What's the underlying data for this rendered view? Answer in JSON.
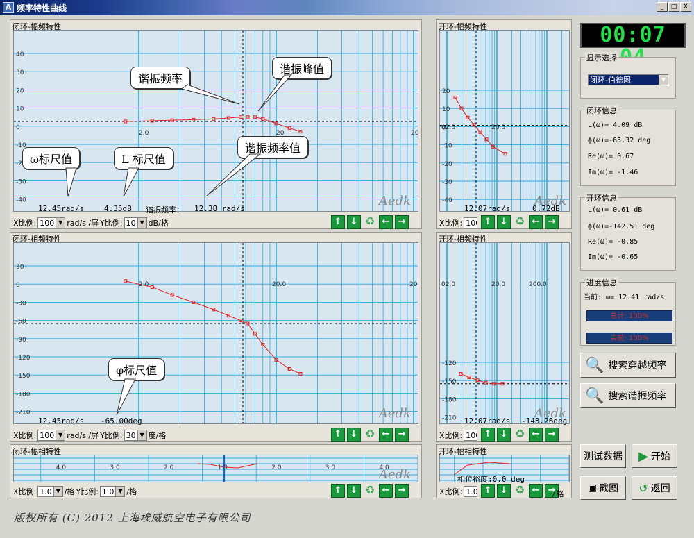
{
  "window": {
    "title": "频率特性曲线",
    "min": "_",
    "max": "□",
    "close": "X"
  },
  "panels": {
    "cl_mag": {
      "title": "闭环-幅频特性",
      "yticks": [
        "40",
        "30",
        "20",
        "10",
        "0",
        "-10",
        "-20",
        "-30",
        "-40"
      ],
      "xticks": [
        "2.0",
        "20",
        "200"
      ],
      "readouts": [
        "12.45rad/s",
        "4.35dB",
        "谐振频率：",
        "12.38 rad/s"
      ],
      "xscale_label": "X比例:",
      "xscale": "100",
      "xunit": "rad/s /屏",
      "yscale_label": "Y比例:",
      "yscale": "10",
      "yunit": "dB/格"
    },
    "cl_phase": {
      "title": "闭环-相频特性",
      "yticks": [
        "30",
        "0",
        "-30",
        "-60",
        "-90",
        "-120",
        "-150",
        "-180",
        "-210"
      ],
      "xticks": [
        "2.0",
        "20.0",
        "200"
      ],
      "readouts": [
        "12.45rad/s",
        "-65.00deg"
      ],
      "xscale_label": "X比例:",
      "xscale": "100",
      "xunit": "rad/s /屏",
      "yscale_label": "Y比例:",
      "yscale": "30",
      "yunit": "度/格"
    },
    "cl_nyq": {
      "title": "闭环-幅相特性",
      "xticks": [
        "4.0",
        "3.0",
        "2.0",
        "1.0",
        "2.0",
        "3.0",
        "4.0"
      ],
      "xscale_label": "X比例:",
      "xscale": "1.0",
      "xunit": "/格",
      "yscale_label": "Y比例:",
      "yscale": "1.0",
      "yunit": "/格"
    },
    "ol_mag": {
      "title": "开环-幅频特性",
      "yticks": [
        "20",
        "10",
        "0",
        "-10",
        "-20",
        "-30",
        "-40"
      ],
      "xticks": [
        "02.0",
        "20.0"
      ],
      "readouts": [
        "12.07rad/s",
        "0.72dB"
      ],
      "xscale_label": "X比例:",
      "xscale": "100"
    },
    "ol_phase": {
      "title": "开环-相频特性",
      "yticks": [
        "-120",
        "-150",
        "-180",
        "-210"
      ],
      "xticks": [
        "02.0",
        "20.0",
        "200.0"
      ],
      "readouts": [
        "12.07rad/s",
        "-143.26deg"
      ],
      "xscale_label": "X比例:",
      "xscale": "100"
    },
    "ol_nyq": {
      "title": "开环-幅相特性",
      "margin": "相位裕度:0.0 deg",
      "xscale_label": "X比例:",
      "xscale": "1.0",
      "yunit": "/格"
    }
  },
  "callouts": {
    "res_freq": "谐振频率",
    "res_peak": "谐振峰值",
    "res_freq_val": "谐振频率值",
    "omega_val": "ω标尺值",
    "l_val": "L 标尺值",
    "phi_val": "φ标尺值"
  },
  "watermark": "Aedk",
  "side": {
    "clock": "00:07 04",
    "display_group": "显示选择",
    "display_value": "闭环-伯德图",
    "cl_info": {
      "title": "闭环信息",
      "lines": [
        "L(ω)=  4.09 dB",
        "ф(ω)=-65.32 deg",
        "Re(ω)=  0.67",
        "Im(ω)= -1.46"
      ]
    },
    "ol_info": {
      "title": "开环信息",
      "lines": [
        "L(ω)=  0.61 dB",
        "ф(ω)=-142.51 deg",
        "Re(ω)= -0.85",
        "Im(ω)= -0.65"
      ]
    },
    "progress": {
      "title": "进度信息",
      "current": "当前: ω= 12.41 rad/s",
      "total": "总计: 100%",
      "now": "当前: 100%"
    },
    "btn_cross": "搜索穿越频率",
    "btn_res": "搜索谐振频率",
    "btn_test": "测试数据",
    "btn_start": "开始",
    "btn_shot": "截图",
    "btn_back": "返回"
  },
  "footer": "版权所有 (C) 2012 上海埃威航空电子有限公司",
  "colors": {
    "plot_bg": "#d8e6ef",
    "grid": "#2fa8dc",
    "curve": "#e02020",
    "button_green": "#1a9a3c"
  },
  "chart_data": [
    {
      "type": "line",
      "title": "闭环-幅频特性",
      "ylim": [
        -40,
        40
      ],
      "xlog": true,
      "x": [
        1.6,
        2.5,
        3.5,
        5,
        7,
        9,
        11,
        12.4,
        14,
        16,
        20,
        25,
        30
      ],
      "y": [
        2.6,
        3.0,
        3.3,
        3.6,
        4.0,
        4.5,
        5.0,
        5.2,
        5.0,
        4.0,
        1.5,
        -1.0,
        -3.0
      ]
    },
    {
      "type": "line",
      "title": "闭环-相频特性",
      "ylim": [
        -210,
        30
      ],
      "xlog": true,
      "x": [
        1.6,
        2.5,
        3.5,
        5,
        7,
        9,
        11,
        12.4,
        14,
        16,
        20,
        25,
        30
      ],
      "y": [
        5,
        -5,
        -18,
        -30,
        -42,
        -52,
        -60,
        -65,
        -82,
        -100,
        -125,
        -140,
        -148
      ]
    },
    {
      "type": "line",
      "title": "开环-幅频特性",
      "ylim": [
        -40,
        20
      ],
      "x": [
        1,
        1.5,
        2,
        2.5,
        3,
        3.5,
        4,
        5
      ],
      "y": [
        16,
        10,
        5,
        1,
        -3,
        -7,
        -11,
        -15
      ]
    },
    {
      "type": "line",
      "title": "开环-相频特性",
      "ylim": [
        -210,
        -100
      ],
      "x": [
        1,
        1.5,
        2,
        2.5,
        3,
        3.5
      ],
      "y": [
        -123,
        -130,
        -136,
        -141,
        -143,
        -143
      ]
    }
  ]
}
